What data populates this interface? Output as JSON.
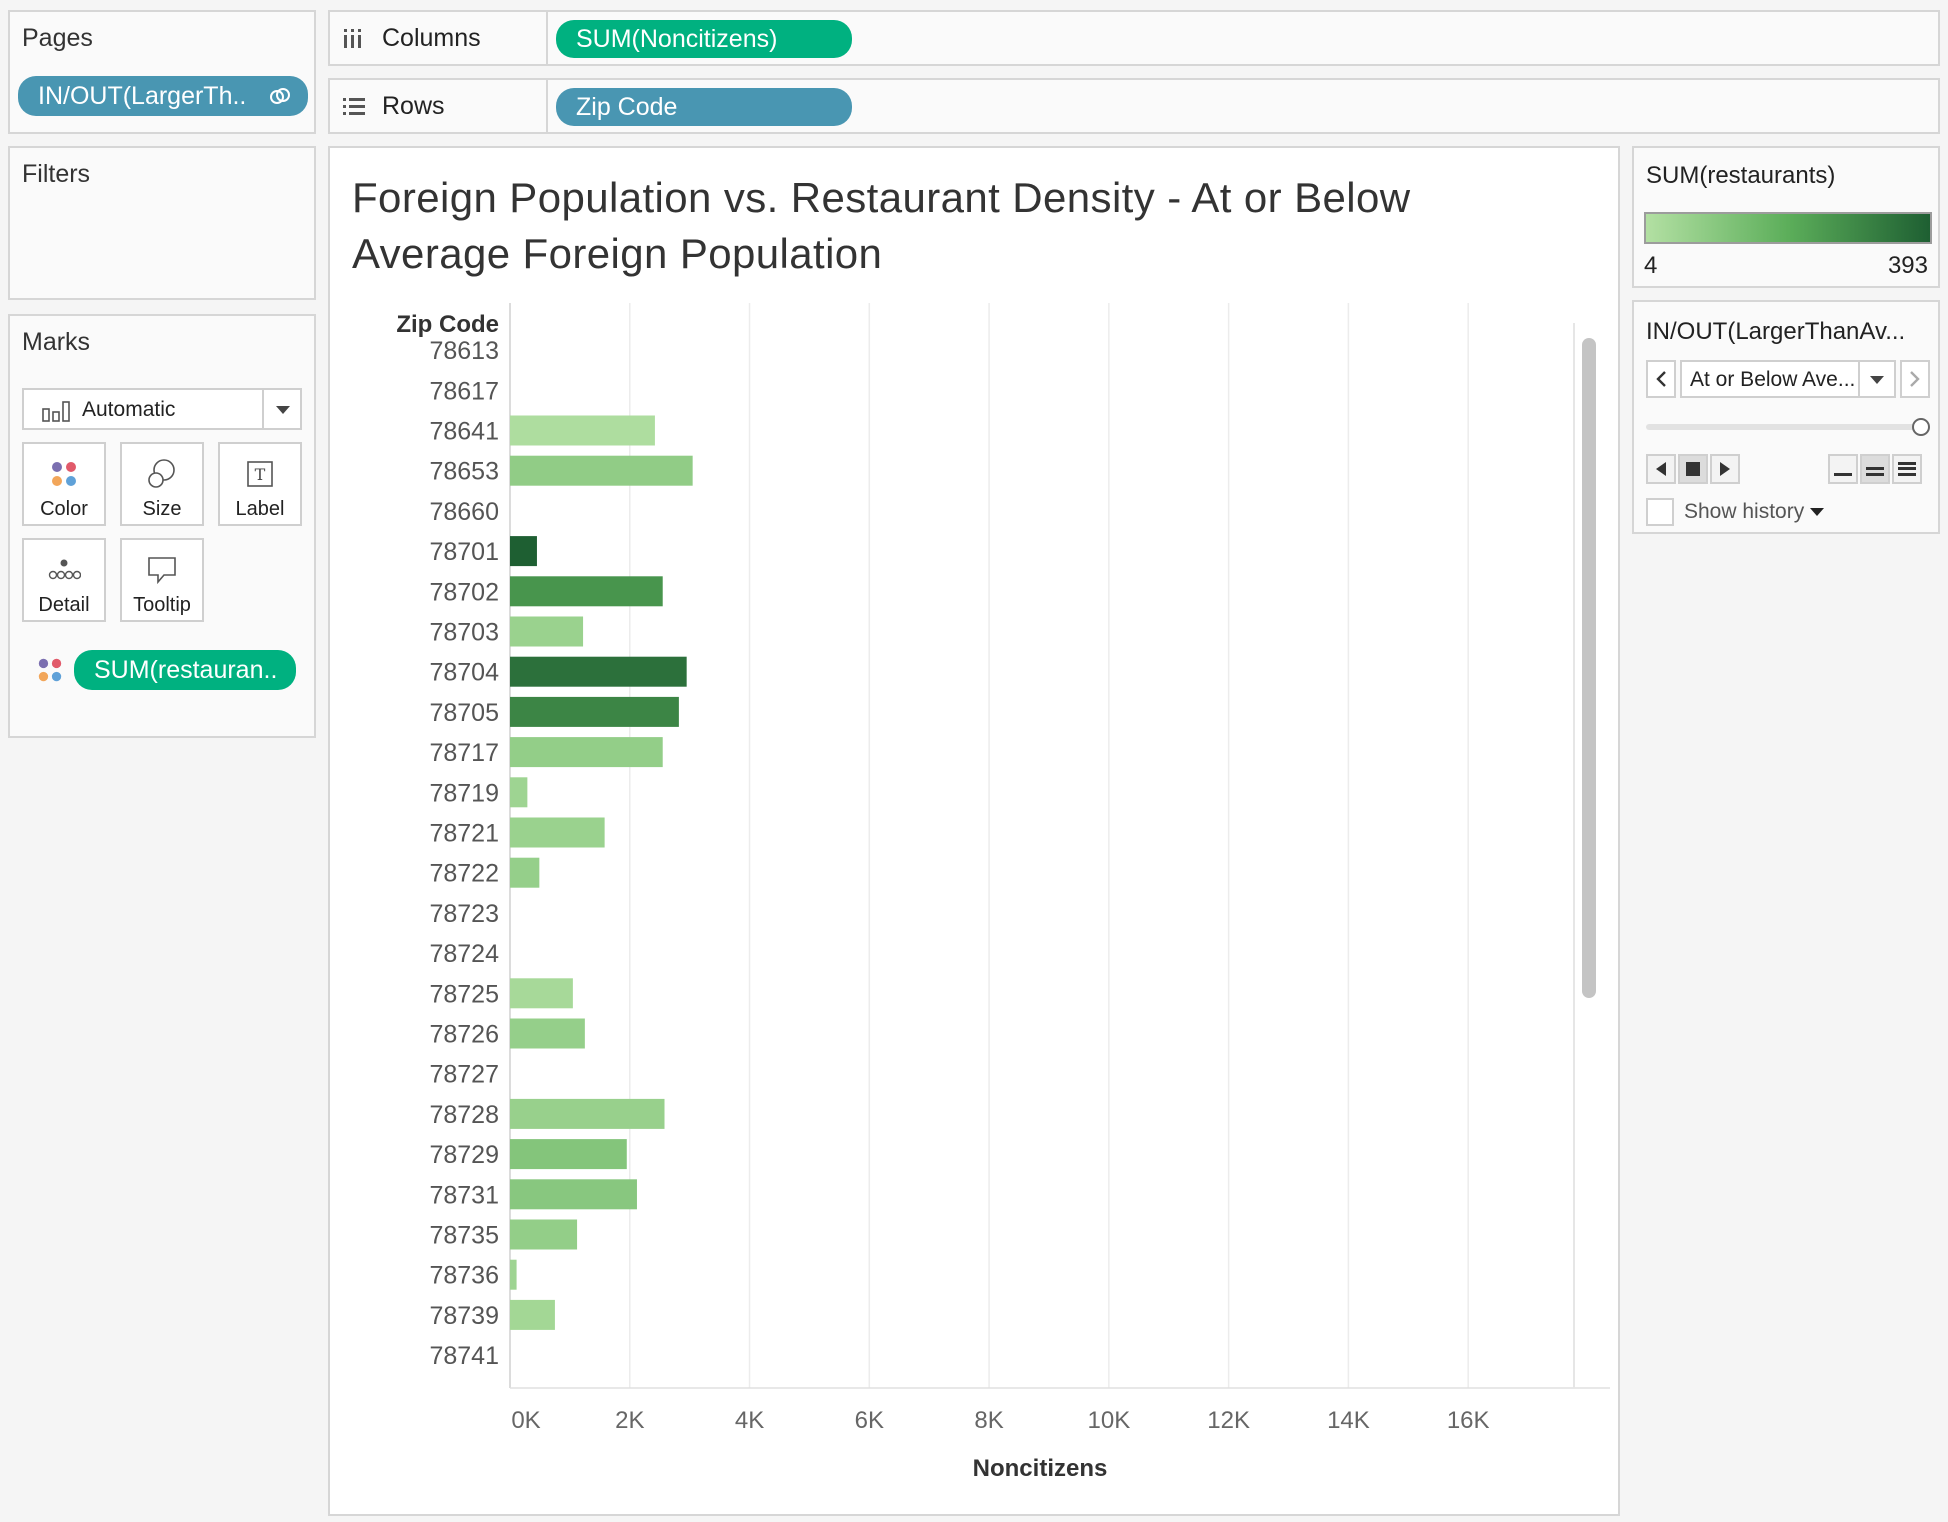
{
  "pages": {
    "title": "Pages",
    "pill": "IN/OUT(LargerTh.."
  },
  "filters": {
    "title": "Filters"
  },
  "marks": {
    "title": "Marks",
    "type": "Automatic",
    "cards": {
      "color": "Color",
      "size": "Size",
      "label": "Label",
      "detail": "Detail",
      "tooltip": "Tooltip"
    },
    "pill": "SUM(restauran.."
  },
  "columns": {
    "label": "Columns",
    "pill": "SUM(Noncitizens)"
  },
  "rows": {
    "label": "Rows",
    "pill": "Zip Code"
  },
  "view": {
    "title": "Foreign Population vs. Restaurant Density - At or Below Average Foreign Population"
  },
  "legend": {
    "title": "SUM(restaurants)",
    "min": "4",
    "max": "393",
    "colors": {
      "low": "#b3e0a3",
      "mid": "#5cae5a",
      "high": "#1e5f32"
    }
  },
  "page_control": {
    "title": "IN/OUT(LargerThanAv...",
    "value": "At or Below Ave...",
    "show_history": "Show history"
  },
  "colors": {
    "pill_blue": "#4996b2",
    "pill_green": "#00b180"
  },
  "chart_data": {
    "type": "bar",
    "orientation": "horizontal",
    "row_header": "Zip Code",
    "xlabel": "Noncitizens",
    "xlim": [
      0,
      17700
    ],
    "x_ticks": [
      "0K",
      "2K",
      "4K",
      "6K",
      "8K",
      "10K",
      "12K",
      "14K",
      "16K"
    ],
    "grid": true,
    "categories": [
      "78613",
      "78617",
      "78641",
      "78653",
      "78660",
      "78701",
      "78702",
      "78703",
      "78704",
      "78705",
      "78717",
      "78719",
      "78721",
      "78722",
      "78723",
      "78724",
      "78725",
      "78726",
      "78727",
      "78728",
      "78729",
      "78731",
      "78735",
      "78736",
      "78739",
      "78741"
    ],
    "values": [
      0,
      0,
      2420,
      3050,
      0,
      450,
      2550,
      1220,
      2950,
      2820,
      2550,
      290,
      1580,
      490,
      0,
      0,
      1050,
      1250,
      0,
      2580,
      1950,
      2120,
      1120,
      110,
      750,
      0
    ],
    "restaurants": [
      0,
      0,
      15,
      80,
      0,
      393,
      260,
      60,
      350,
      300,
      75,
      50,
      60,
      70,
      0,
      0,
      30,
      70,
      0,
      65,
      110,
      100,
      75,
      50,
      40,
      0
    ]
  }
}
